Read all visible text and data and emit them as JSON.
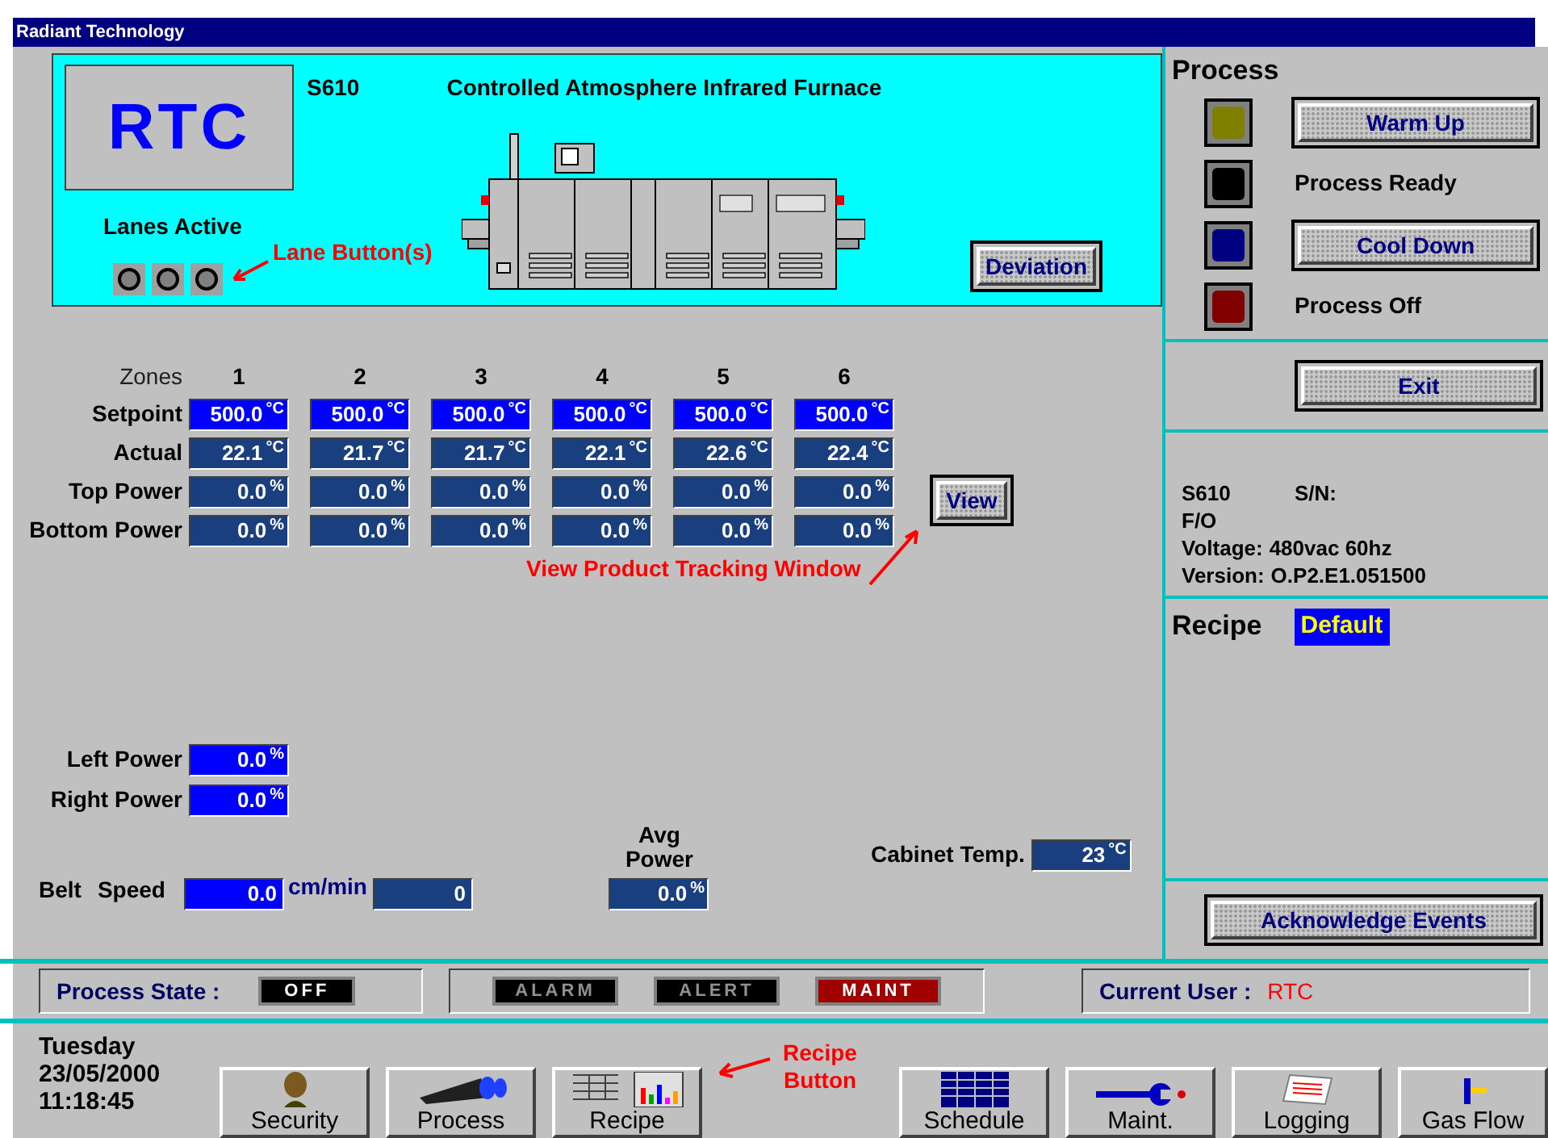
{
  "window": {
    "title": "Radiant Technology"
  },
  "header": {
    "logo": "RTC",
    "model": "S610",
    "title": "Controlled Atmosphere Infrared Furnace",
    "lanes_label": "Lanes Active",
    "lanes": [
      {
        "on": false
      },
      {
        "on": false
      },
      {
        "on": false
      }
    ],
    "deviation_button": "Deviation"
  },
  "annotations": [
    {
      "kind": "lanes",
      "text": "Lane Button(s)"
    },
    {
      "kind": "view",
      "text": "View Product Tracking Window"
    },
    {
      "kind": "recipe",
      "text": "Recipe Button"
    }
  ],
  "zones": {
    "label": "Zones",
    "columns": [
      "1",
      "2",
      "3",
      "4",
      "5",
      "6"
    ],
    "rows": [
      {
        "kind": "setpoint",
        "label": "Setpoint",
        "cells": [
          {
            "value": "500.0",
            "unit": "°C"
          },
          {
            "value": "500.0",
            "unit": "°C"
          },
          {
            "value": "500.0",
            "unit": "°C"
          },
          {
            "value": "500.0",
            "unit": "°C"
          },
          {
            "value": "500.0",
            "unit": "°C"
          },
          {
            "value": "500.0",
            "unit": "°C"
          }
        ]
      },
      {
        "kind": "reading",
        "label": "Actual",
        "cells": [
          {
            "value": "22.1",
            "unit": "°C"
          },
          {
            "value": "21.7",
            "unit": "°C"
          },
          {
            "value": "21.7",
            "unit": "°C"
          },
          {
            "value": "22.1",
            "unit": "°C"
          },
          {
            "value": "22.6",
            "unit": "°C"
          },
          {
            "value": "22.4",
            "unit": "°C"
          }
        ]
      },
      {
        "kind": "reading",
        "label": "Top Power",
        "cells": [
          {
            "value": "0.0",
            "unit": "%"
          },
          {
            "value": "0.0",
            "unit": "%"
          },
          {
            "value": "0.0",
            "unit": "%"
          },
          {
            "value": "0.0",
            "unit": "%"
          },
          {
            "value": "0.0",
            "unit": "%"
          },
          {
            "value": "0.0",
            "unit": "%"
          }
        ]
      },
      {
        "kind": "reading",
        "label": "Bottom Power",
        "cells": [
          {
            "value": "0.0",
            "unit": "%"
          },
          {
            "value": "0.0",
            "unit": "%"
          },
          {
            "value": "0.0",
            "unit": "%"
          },
          {
            "value": "0.0",
            "unit": "%"
          },
          {
            "value": "0.0",
            "unit": "%"
          },
          {
            "value": "0.0",
            "unit": "%"
          }
        ]
      }
    ],
    "view_button": "View"
  },
  "power": [
    {
      "label": "Left Power",
      "value": "0.0",
      "unit": "%"
    },
    {
      "label": "Right Power",
      "value": "0.0",
      "unit": "%"
    }
  ],
  "belt": {
    "label_1": "Belt",
    "label_2": "Speed",
    "value": "0.0",
    "unit": "cm/min",
    "count": "0"
  },
  "avg_power": {
    "label": "Avg Power",
    "value": "0.0",
    "unit": "%"
  },
  "cabinet": {
    "label": "Cabinet Temp.",
    "value": "23",
    "unit": "°C"
  },
  "process": {
    "title": "Process",
    "items": [
      {
        "kind": "button",
        "label": "Warm Up",
        "color": "#808000"
      },
      {
        "kind": "text",
        "label": "Process Ready",
        "color": "#000000"
      },
      {
        "kind": "button",
        "label": "Cool Down",
        "color": "#000080"
      },
      {
        "kind": "text",
        "label": "Process Off",
        "color": "#800000"
      }
    ]
  },
  "exit_button": "Exit",
  "info": [
    {
      "label": "S610",
      "value": "S/N:"
    },
    {
      "label": "F/O"
    },
    {
      "label": "Voltage:",
      "value": "480vac 60hz"
    },
    {
      "label": "Version:",
      "value": "O.P2.E1.051500"
    }
  ],
  "recipe": {
    "label": "Recipe",
    "value": "Default"
  },
  "acknowledge_button": "Acknowledge Events",
  "status_bar": {
    "state_label": "Process State :",
    "state": "OFF",
    "indicators": [
      {
        "label": "ALARM",
        "active": false
      },
      {
        "label": "ALERT",
        "active": false
      },
      {
        "label": "MAINT",
        "active": true
      }
    ],
    "user_label": "Current User :",
    "user": "RTC"
  },
  "clock": {
    "day": "Tuesday",
    "date": "23/05/2000",
    "time": "11:18:45"
  },
  "toolbar": [
    {
      "kind": "security",
      "label": "Security"
    },
    {
      "kind": "process",
      "label": "Process"
    },
    {
      "kind": "recipe",
      "label": "Recipe"
    },
    {
      "kind": "gap"
    },
    {
      "kind": "schedule",
      "label": "Schedule"
    },
    {
      "kind": "maint",
      "label": "Maint."
    },
    {
      "kind": "logging",
      "label": "Logging"
    },
    {
      "kind": "gasflow",
      "label": "Gas Flow"
    }
  ]
}
